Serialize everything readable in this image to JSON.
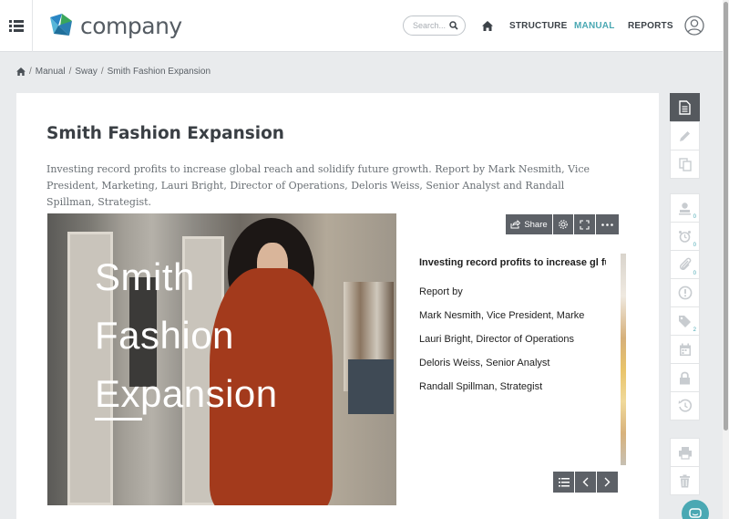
{
  "header": {
    "logo_text": "company",
    "search_placeholder": "Search...",
    "nav": {
      "structure": "STRUCTURE",
      "manual": "MANUAL",
      "reports": "REPORTS"
    },
    "active_color": "#4aa8b3"
  },
  "breadcrumb": [
    "Manual",
    "Sway",
    "Smith Fashion Expansion"
  ],
  "page": {
    "title": "Smith Fashion Expansion",
    "description": "Investing record profits to increase global reach and solidify future growth. Report by Mark Nesmith, Vice President, Marketing, Lauri Bright, Director of Operations, Deloris Weiss, Senior Analyst and Randall Spillman, Strategist."
  },
  "sway": {
    "hero_title_lines": [
      "Smith",
      "Fashion",
      "Expansion"
    ],
    "share_label": "Share",
    "heading": "Investing record profits to increase gl future growth",
    "lines": [
      "Report by",
      "Mark  Nesmith, Vice President, Marke",
      "Lauri  Bright, Director of Operations",
      "Deloris  Weiss, Senior Analyst",
      "Randall  Spillman, Strategist"
    ]
  },
  "tools": {
    "counts": {
      "users": "0",
      "alarm": "0",
      "attachments": "0",
      "tags": "2"
    },
    "icons": [
      "document-icon",
      "pencil-icon",
      "copy-icon",
      "user-stamp-icon",
      "alarm-icon",
      "paperclip-icon",
      "info-icon",
      "tag-icon",
      "calendar-icon",
      "lock-icon",
      "history-icon",
      "print-icon",
      "trash-icon"
    ]
  }
}
